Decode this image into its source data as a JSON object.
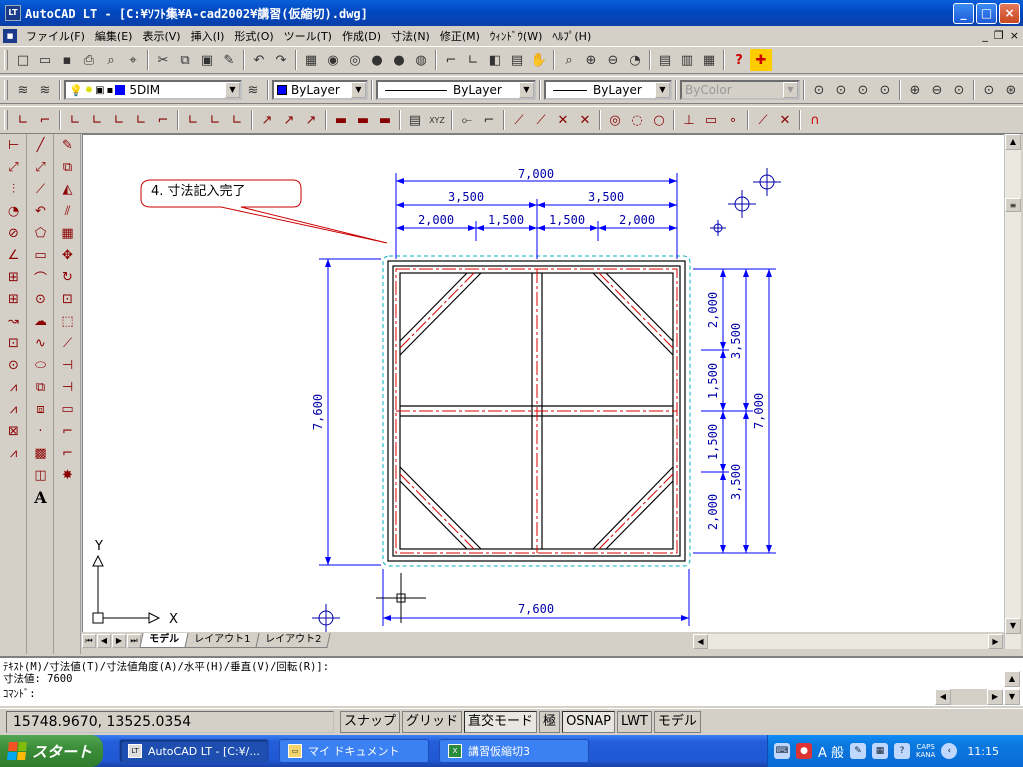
{
  "window": {
    "title": "AutoCAD LT - [C:¥ｿﾌﾄ集¥A-cad2002¥講習(仮縮切).dwg]",
    "app_icon": "LT"
  },
  "menu": [
    "ファイル(F)",
    "編集(E)",
    "表示(V)",
    "挿入(I)",
    "形式(O)",
    "ツール(T)",
    "作成(D)",
    "寸法(N)",
    "修正(M)",
    "ｳｨﾝﾄﾞｳ(W)",
    "ﾍﾙﾌﾟ(H)"
  ],
  "layer_toolbar": {
    "layer": "5DIM",
    "color": "ByLayer",
    "linetype": "ByLayer",
    "lineweight": "ByLayer",
    "plotstyle": "ByColor"
  },
  "drawing": {
    "callout": "4. 寸法記入完了",
    "dims": {
      "top_total": "7,000",
      "top_half_left": "3,500",
      "top_half_right": "3,500",
      "top_a": "2,000",
      "top_b": "1,500",
      "top_c": "1,500",
      "top_d": "2,000",
      "left": "7,600",
      "bottom": "7,600",
      "right_a": "2,000",
      "right_b": "1,500",
      "right_c": "1,500",
      "right_d": "2,000",
      "right_half_top": "3,500",
      "right_half_bottom": "3,500",
      "right_total": "7,000"
    },
    "ucs_x": "X",
    "ucs_y": "Y"
  },
  "tabs": [
    "モデル",
    "レイアウト1",
    "レイアウト2"
  ],
  "command": {
    "line1": "ﾃｷｽﾄ(M)/寸法値(T)/寸法値角度(A)/水平(H)/垂直(V)/回転(R)]:",
    "line2": "寸法値: 7600",
    "prompt": "ｺﾏﾝﾄﾞ:"
  },
  "status": {
    "coords": "15748.9670, 13525.0354",
    "snap": "スナップ",
    "grid": "グリッド",
    "ortho": "直交モード",
    "polar": "極",
    "osnap": "OSNAP",
    "lwt": "LWT",
    "model": "モデル"
  },
  "taskbar": {
    "start": "スタート",
    "items": [
      "AutoCAD LT - [C:¥/...",
      "マイ ドキュメント",
      "講習仮縮切3"
    ],
    "ime": "A 般",
    "caps": "CAPS",
    "kana": "KANA",
    "time": "11:15"
  }
}
